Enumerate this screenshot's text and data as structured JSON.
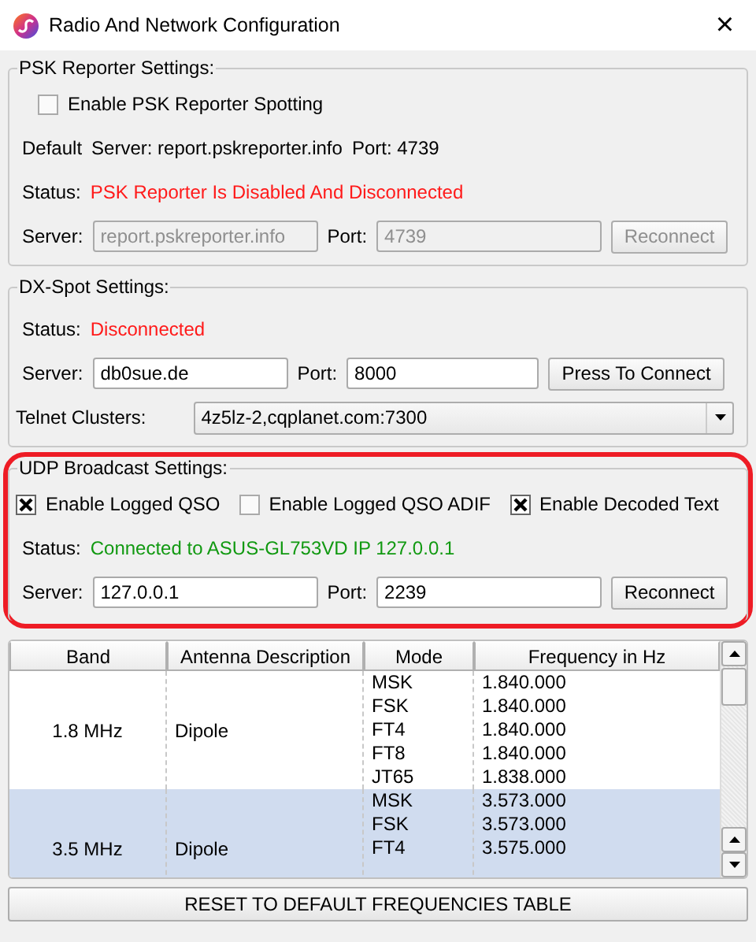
{
  "window": {
    "title": "Radio And Network Configuration",
    "close": "×"
  },
  "psk_reporter": {
    "legend": "PSK Reporter Settings:",
    "enable": {
      "label": "Enable PSK Reporter Spotting",
      "checked": false
    },
    "default_label": "Default",
    "default_server": "Server: report.pskreporter.info",
    "default_port": "Port: 4739",
    "status_label": "Status:",
    "status": "PSK Reporter Is Disabled And Disconnected",
    "connected": false,
    "server_label": "Server:",
    "server": "report.pskreporter.info",
    "port_label": "Port:",
    "port": "4739",
    "button": "Reconnect",
    "disabled": true
  },
  "dx_spot": {
    "legend": "DX-Spot Settings:",
    "status_label": "Status:",
    "status": "Disconnected",
    "connected": false,
    "server_label": "Server:",
    "server": "db0sue.de",
    "port_label": "Port:",
    "port": "8000",
    "button": "Press To Connect",
    "clusters_label": "Telnet Clusters:",
    "cluster": "4z5lz-2,cqplanet.com:7300"
  },
  "udp": {
    "legend": "UDP Broadcast Settings:",
    "highlighted": true,
    "options": [
      {
        "label": "Enable Logged QSO",
        "checked": true
      },
      {
        "label": "Enable Logged QSO ADIF",
        "checked": false
      },
      {
        "label": "Enable Decoded Text",
        "checked": true
      }
    ],
    "status_label": "Status:",
    "status": "Connected to ASUS-GL753VD IP 127.0.0.1",
    "connected": true,
    "server_label": "Server:",
    "server": "127.0.0.1",
    "port_label": "Port:",
    "port": "2239",
    "button": "Reconnect"
  },
  "table": {
    "columns": [
      "Band",
      "Antenna Description",
      "Mode",
      "Frequency in Hz"
    ],
    "rows": [
      {
        "band": "1.8 MHz",
        "antenna": "Dipole",
        "selected": false,
        "modes": [
          {
            "mode": "MSK",
            "frequency": "1.840.000"
          },
          {
            "mode": "FSK",
            "frequency": "1.840.000"
          },
          {
            "mode": "FT4",
            "frequency": "1.840.000"
          },
          {
            "mode": "FT8",
            "frequency": "1.840.000"
          },
          {
            "mode": "JT65",
            "frequency": "1.838.000"
          }
        ]
      },
      {
        "band": "3.5 MHz",
        "antenna": "Dipole",
        "selected": true,
        "modes": [
          {
            "mode": "MSK",
            "frequency": "3.573.000"
          },
          {
            "mode": "FSK",
            "frequency": "3.573.000"
          },
          {
            "mode": "FT4",
            "frequency": "3.575.000"
          }
        ]
      }
    ]
  },
  "reset_button": "RESET TO DEFAULT FREQUENCIES TABLE"
}
